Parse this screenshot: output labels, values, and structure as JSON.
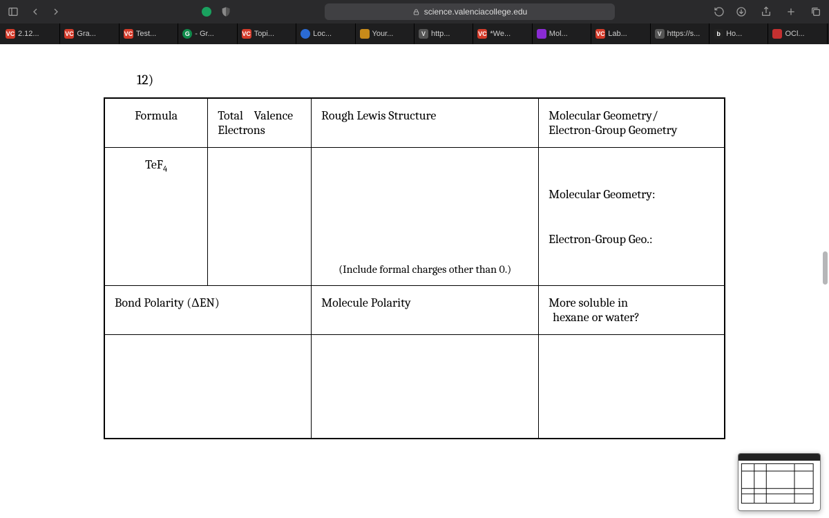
{
  "chrome": {
    "address": "science.valenciacollege.edu"
  },
  "tabs": [
    {
      "fav": "vc",
      "label": "2.12..."
    },
    {
      "fav": "vc",
      "label": "Gra..."
    },
    {
      "fav": "vc",
      "label": "Test..."
    },
    {
      "fav": "g",
      "label": "- Gr..."
    },
    {
      "fav": "vc",
      "label": "Topi..."
    },
    {
      "fav": "blue",
      "label": "Loc..."
    },
    {
      "fav": "amber",
      "label": "Your..."
    },
    {
      "fav": "v",
      "label": "http..."
    },
    {
      "fav": "vc",
      "label": "*We..."
    },
    {
      "fav": "phet",
      "label": "Mol..."
    },
    {
      "fav": "vc",
      "label": "Lab..."
    },
    {
      "fav": "v",
      "label": "https://s..."
    },
    {
      "fav": "b",
      "label": "Ho..."
    },
    {
      "fav": "oci",
      "label": "OCl..."
    }
  ],
  "worksheet": {
    "question_number": "12)",
    "headers": {
      "formula": "Formula",
      "valence_line1": "Total    Valence",
      "valence_line2": "Electrons",
      "lewis": "Rough Lewis Structure",
      "geom_line1": "Molecular Geometry/",
      "geom_line2": "Electron-Group Geometry"
    },
    "body": {
      "formula_main": "TeF",
      "formula_sub": "4",
      "lewis_note": "(Include formal charges other than 0.)",
      "mol_geom_label": "Molecular Geometry:",
      "eg_geom_label": "Electron-Group Geo.:"
    },
    "row3": {
      "bond_polarity": "Bond Polarity (ΔEN)",
      "molecule_polarity": "Molecule Polarity",
      "soluble_line1": "More soluble in",
      "soluble_line2": "hexane or water?"
    }
  }
}
